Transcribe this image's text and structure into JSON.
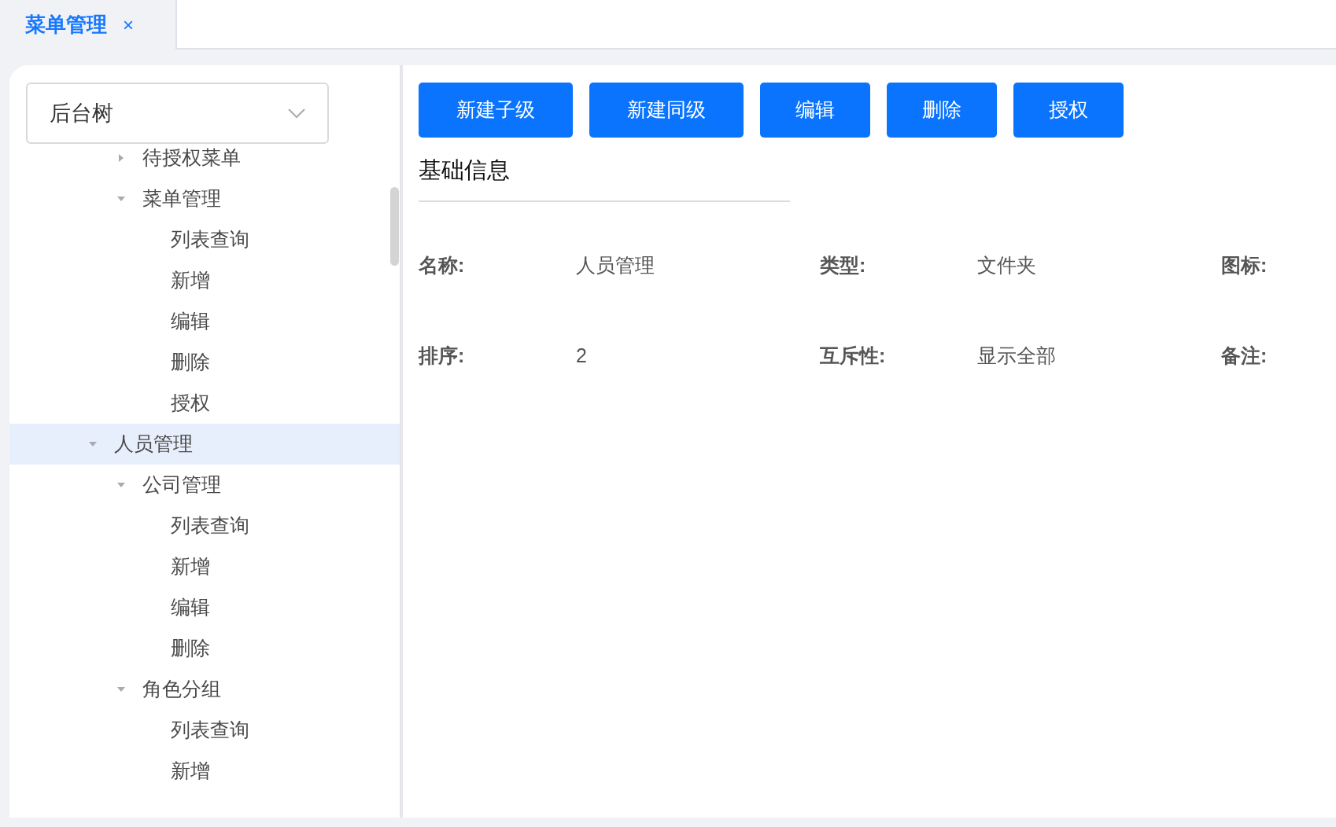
{
  "tabs": [
    {
      "label": "菜单管理",
      "selected": true,
      "close": "×"
    }
  ],
  "tree": {
    "select": {
      "value": "后台树"
    },
    "nested_items": [
      {
        "label": "待授权菜单",
        "expanded": false,
        "selected": false
      },
      {
        "label": "菜单管理",
        "expanded": true,
        "selected": false,
        "children": [
          {
            "label": "列表查询",
            "selected": false
          },
          {
            "label": "新增",
            "selected": false
          },
          {
            "label": "编辑",
            "selected": false
          },
          {
            "label": "删除",
            "selected": false
          },
          {
            "label": "授权",
            "selected": false
          }
        ]
      }
    ],
    "items": [
      {
        "label": "人员管理",
        "expanded": true,
        "selected": true,
        "children": [
          {
            "label": "公司管理",
            "expanded": true,
            "selected": false,
            "children": [
              {
                "label": "列表查询",
                "selected": false
              },
              {
                "label": "新增",
                "selected": false
              },
              {
                "label": "编辑",
                "selected": false
              },
              {
                "label": "删除",
                "selected": false
              }
            ]
          },
          {
            "label": "角色分组",
            "expanded": true,
            "selected": false,
            "children": [
              {
                "label": "列表查询",
                "selected": false
              },
              {
                "label": "新增",
                "selected": false
              }
            ]
          }
        ]
      }
    ]
  },
  "toolbar": [
    "新建子级",
    "新建同级",
    "编辑",
    "删除",
    "授权"
  ],
  "section_title": "基础信息",
  "fields": [
    {
      "label": "名称:",
      "value": "人员管理"
    },
    {
      "label": "类型:",
      "value": "文件夹"
    },
    {
      "label": "图标:"
    },
    {
      "label": "排序:",
      "value": "2"
    },
    {
      "label": "互斥性:",
      "value": "显示全部"
    },
    {
      "label": "备注:"
    }
  ]
}
